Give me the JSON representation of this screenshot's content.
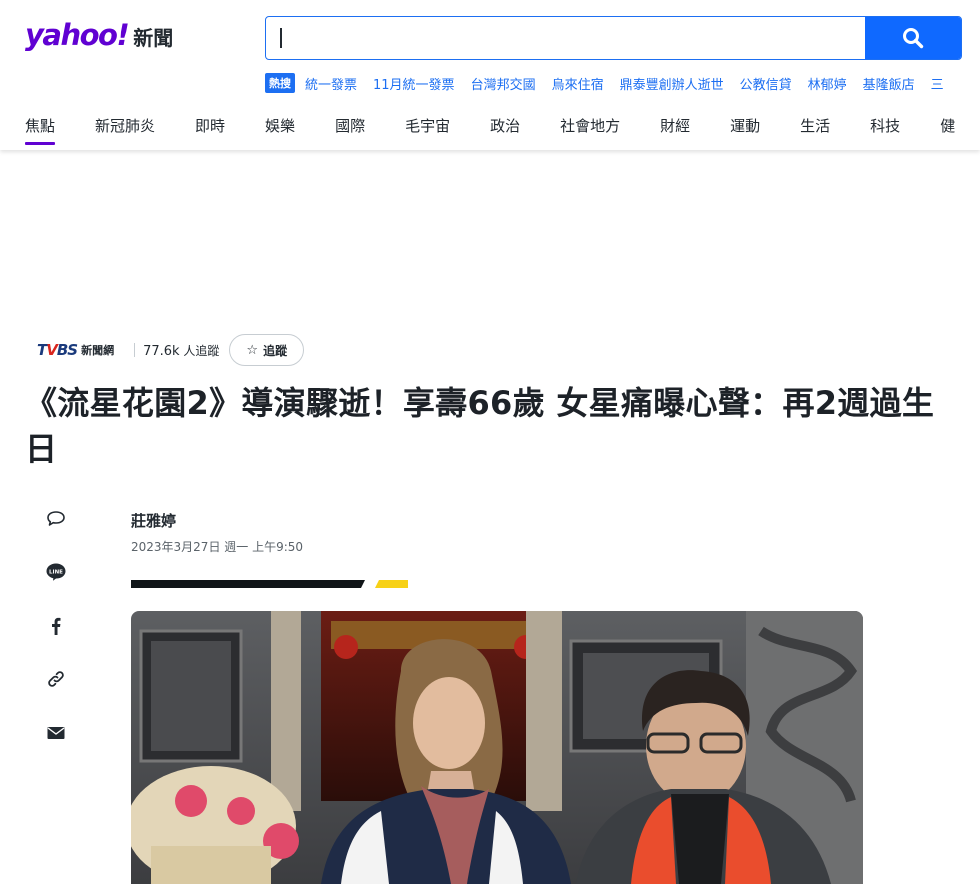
{
  "header": {
    "logo_brand": "yahoo!",
    "logo_section": "新聞",
    "search": {
      "value": "",
      "placeholder": ""
    },
    "hot_label": "熱搜",
    "trending": [
      "統一發票",
      "11月統一發票",
      "台灣邦交國",
      "烏來住宿",
      "鼎泰豐創辦人逝世",
      "公教信貸",
      "林郁婷",
      "基隆飯店",
      "三"
    ],
    "nav": [
      "焦點",
      "新冠肺炎",
      "即時",
      "娛樂",
      "國際",
      "毛宇宙",
      "政治",
      "社會地方",
      "財經",
      "運動",
      "生活",
      "科技",
      "健"
    ]
  },
  "publisher": {
    "name_text": "新聞網",
    "followers_count": "77.6k",
    "followers_label": "人追蹤",
    "follow_label": "追蹤"
  },
  "article": {
    "headline": "《流星花園2》導演驟逝！享壽66歲 女星痛曝心聲：再2週過生日",
    "author": "莊雅婷",
    "date": "2023年3月27日 週一 上午9:50"
  },
  "share_icons": [
    "comment-icon",
    "line-icon",
    "facebook-icon",
    "link-icon",
    "mail-icon"
  ],
  "colors": {
    "brand_purple": "#6001d2",
    "search_blue": "#0f69ff",
    "link_blue": "#1d6ff2",
    "accent_yellow": "#f7d117"
  }
}
